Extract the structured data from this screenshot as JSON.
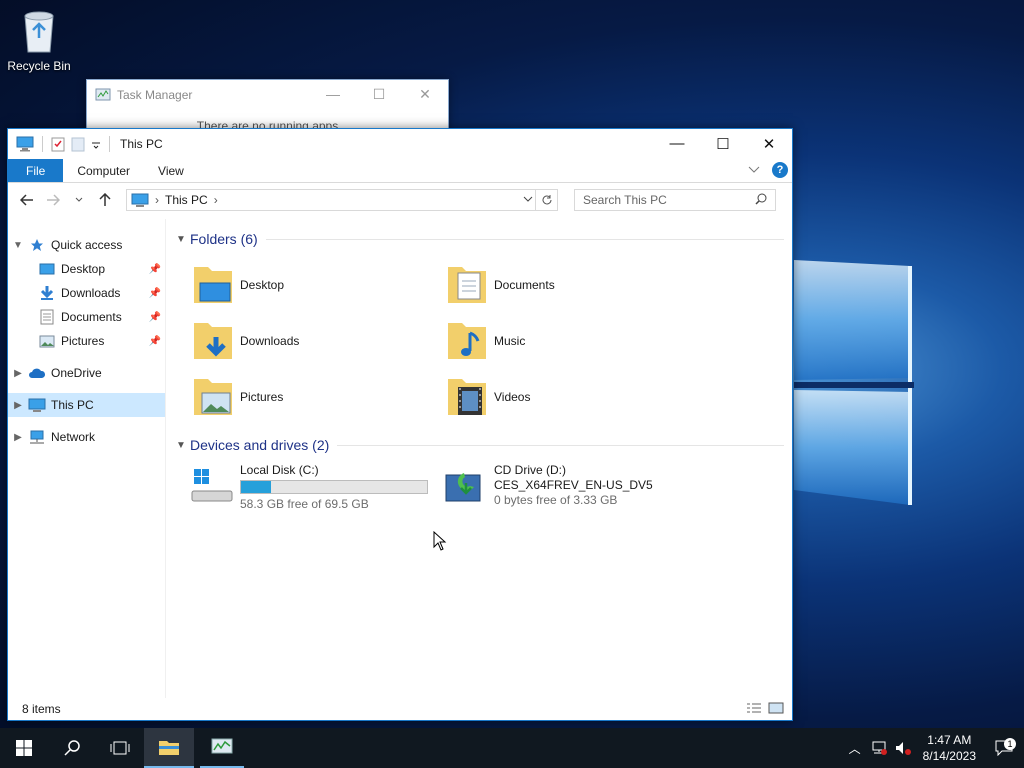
{
  "desktop": {
    "recycle_bin_label": "Recycle Bin"
  },
  "task_manager": {
    "title": "Task Manager",
    "message": "There are no running apps",
    "min": "—",
    "max": "☐",
    "close": "✕"
  },
  "explorer": {
    "title": "This PC",
    "controls": {
      "min": "—",
      "max": "☐",
      "close": "✕"
    },
    "ribbon_tabs": [
      "File",
      "Computer",
      "View"
    ],
    "help": "?",
    "address": {
      "location": "This PC",
      "sep": "›"
    },
    "search_placeholder": "Search This PC",
    "nav": {
      "quick_access": "Quick access",
      "quick_items": [
        "Desktop",
        "Downloads",
        "Documents",
        "Pictures"
      ],
      "onedrive": "OneDrive",
      "this_pc": "This PC",
      "network": "Network"
    },
    "folders_header": "Folders (6)",
    "folders": [
      "Desktop",
      "Documents",
      "Downloads",
      "Music",
      "Pictures",
      "Videos"
    ],
    "drives_header": "Devices and drives (2)",
    "drives": [
      {
        "name": "Local Disk (C:)",
        "free": "58.3 GB free of 69.5 GB",
        "used_fraction": 0.16
      },
      {
        "name": "CD Drive (D:)",
        "label": "CES_X64FREV_EN-US_DV5",
        "free": "0 bytes free of 3.33 GB"
      }
    ],
    "status": "8 items"
  },
  "taskbar": {
    "time": "1:47 AM",
    "date": "8/14/2023",
    "notif_count": "1"
  },
  "icons": {
    "start": "windows-logo-icon",
    "search": "search-icon",
    "taskview": "task-view-icon"
  }
}
